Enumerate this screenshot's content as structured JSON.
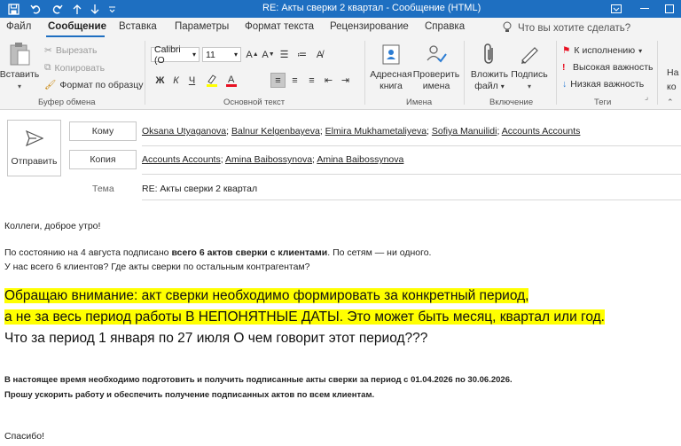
{
  "titlebar": {
    "title": "RE: Акты сверки 2 квартал  -  Сообщение (HTML)"
  },
  "tabs": [
    {
      "label": "Файл"
    },
    {
      "label": "Сообщение"
    },
    {
      "label": "Вставка"
    },
    {
      "label": "Параметры"
    },
    {
      "label": "Формат текста"
    },
    {
      "label": "Рецензирование"
    },
    {
      "label": "Справка"
    }
  ],
  "tellme": "Что вы хотите сделать?",
  "ribbon": {
    "paste": "Вставить",
    "cut": "Вырезать",
    "copy": "Копировать",
    "format_painter": "Формат по образцу",
    "clipboard_group": "Буфер обмена",
    "font_name": "Calibri (О",
    "font_size": "11",
    "basic_text_group": "Основной текст",
    "address_book": [
      "Адресная",
      "книга"
    ],
    "check_names": [
      "Проверить",
      "имена"
    ],
    "names_group": "Имена",
    "attach_file": [
      "Вложить",
      "файл"
    ],
    "signature": [
      "Подпись"
    ],
    "include_group": "Включение",
    "followup": "К исполнению",
    "high_importance": "Высокая важность",
    "low_importance": "Низкая важность",
    "tags_group": "Теги",
    "cut_off": [
      "На",
      "ко"
    ]
  },
  "header": {
    "send": "Отправить",
    "to_label": "Кому",
    "cc_label": "Копия",
    "subject_label": "Тема",
    "to": [
      "Oksana Utyaganova",
      "Balnur Kelgenbayeva",
      "Elmira Mukhametaliyeva",
      "Sofiya Manuilidi",
      "Accounts Accounts"
    ],
    "cc": [
      "Accounts Accounts",
      "Amina Baibossynova",
      "Amina Baibossynova"
    ],
    "subject": "RE: Акты сверки 2 квартал"
  },
  "body": {
    "greeting": "Коллеги, доброе утро!",
    "line1_a": "По состоянию на 4 августа подписано ",
    "line1_b": "всего 6 актов сверки с клиентами",
    "line1_c": ". По сетям — ни одного.",
    "line2": "У нас всего 6 клиентов? Где акты сверки по остальным контрагентам?",
    "big1": "Обращаю внимание: акт сверки необходимо формировать за конкретный период,",
    "big2": "а не за весь период работы В НЕПОНЯТНЫЕ ДАТЫ. Это может быть месяц, квартал или год.",
    "big3": "Что за период 1 января по 27 июля О чем говорит этот период???",
    "bold1": "В настоящее время необходимо подготовить и получить подписанные акты сверки за период с 01.04.2026 по 30.06.2026.",
    "bold2": "Прошу ускорить работу и обеспечить получение подписанных актов по всем клиентам.",
    "thanks": "Спасибо!"
  },
  "colors": {
    "titlebar": "#1e6fc1",
    "highlight": "#ffff00",
    "ribbon_bg": "#f3f3f3"
  }
}
